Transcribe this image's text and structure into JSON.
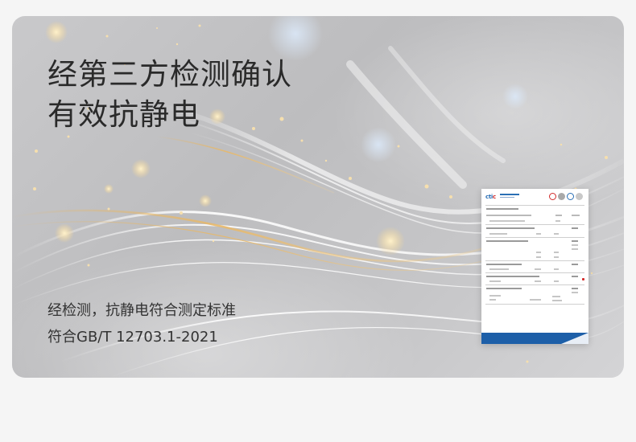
{
  "headline": {
    "line1": "经第三方检测确认",
    "line2": "有效抗静电"
  },
  "description": {
    "line1": "经检测，抗静电符合测定标准",
    "line2": "符合GB/T 12703.1-2021"
  },
  "report": {
    "logo_text_a": "cti",
    "logo_text_b": "c"
  },
  "colors": {
    "background": "#f5f5f5",
    "card": "#c4c4c6",
    "headline": "#2a2a2a",
    "report_footer": "#1d5fa8"
  }
}
